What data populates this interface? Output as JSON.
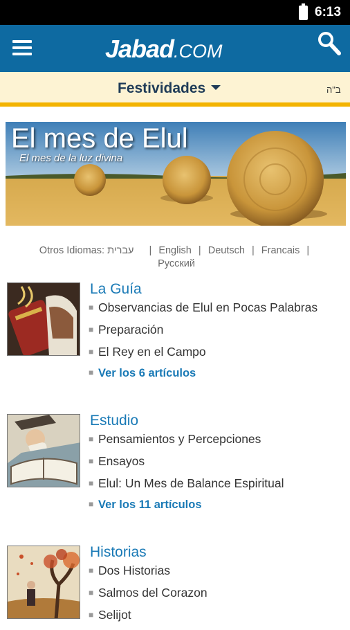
{
  "status": {
    "time": "6:13"
  },
  "header": {
    "logo_main": "Jabad",
    "logo_tld": ".COM"
  },
  "subheader": {
    "section": "Festividades",
    "hebrew_mark": "ב\"ה"
  },
  "banner": {
    "title": "El mes de Elul",
    "subtitle": "El mes de la luz divina"
  },
  "languages": {
    "label": "Otros Idiomas:",
    "items": [
      "עברית",
      "English",
      "Deutsch",
      "Francais",
      "Русский"
    ],
    "separator": "|"
  },
  "sections": [
    {
      "title": "La Guía",
      "items": [
        "Observancias de Elul en Pocas Palabras",
        "Preparación",
        "El Rey en el Campo"
      ],
      "more": "Ver los 6 artículos"
    },
    {
      "title": "Estudio",
      "items": [
        "Pensamientos y Percepciones",
        "Ensayos",
        "Elul: Un Mes de Balance Espiritual"
      ],
      "more": "Ver los 11 artículos"
    },
    {
      "title": "Historias",
      "items": [
        "Dos Historias",
        "Salmos del Corazon",
        "Selijot"
      ],
      "more": ""
    }
  ],
  "colors": {
    "appbar": "#0e6aa1",
    "accent": "#f3b300",
    "link": "#1a7ab6",
    "subbar": "#fdf3d3"
  },
  "icons": [
    "battery-icon",
    "menu-icon",
    "search-icon",
    "dropdown-caret-icon",
    "bullet-icon"
  ]
}
